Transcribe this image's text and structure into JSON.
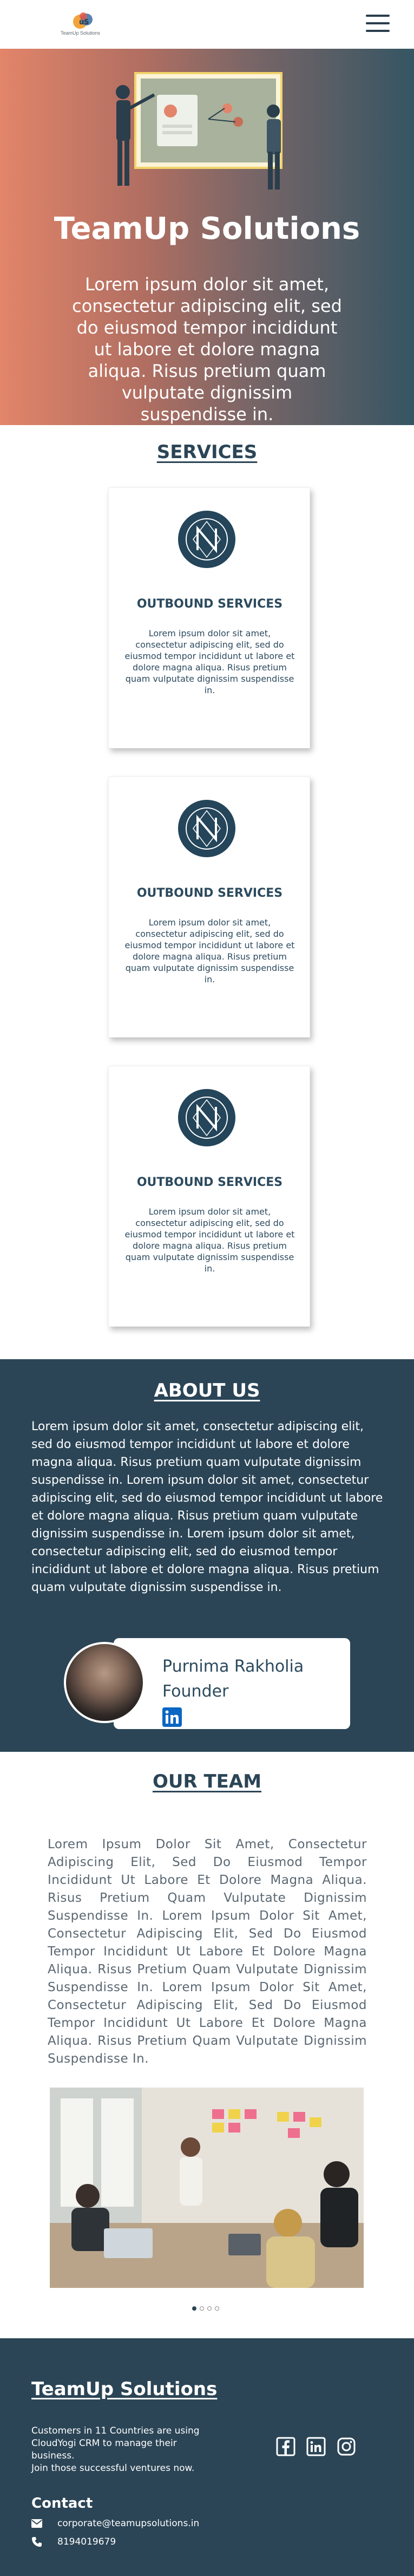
{
  "header": {
    "logo_text": "TeamUp Solutions",
    "menu_icon": "hamburger-menu-icon"
  },
  "hero": {
    "title": "TeamUp Solutions",
    "text": "Lorem ipsum dolor sit amet, consectetur adipiscing elit, sed do eiusmod tempor incididunt ut labore et dolore magna aliqua. Risus pretium quam vulputate dignissim suspendisse in.",
    "gradient": [
      "#e2856a",
      "#355563"
    ]
  },
  "services": {
    "heading": "SERVICES",
    "cards": [
      {
        "icon": "n-logo-icon",
        "title": "OUTBOUND SERVICES",
        "text": "Lorem ipsum dolor sit amet, consectetur adipiscing elit, sed do eiusmod tempor incididunt ut labore et dolore magna aliqua. Risus pretium quam vulputate dignissim suspendisse in."
      },
      {
        "icon": "n-logo-icon",
        "title": "OUTBOUND SERVICES",
        "text": "Lorem ipsum dolor sit amet, consectetur adipiscing elit, sed do eiusmod tempor incididunt ut labore et dolore magna aliqua. Risus pretium quam vulputate dignissim suspendisse in."
      },
      {
        "icon": "n-logo-icon",
        "title": "OUTBOUND SERVICES",
        "text": "Lorem ipsum dolor sit amet, consectetur adipiscing elit, sed do eiusmod tempor incididunt ut labore et dolore magna aliqua. Risus pretium quam vulputate dignissim suspendisse in."
      }
    ]
  },
  "about": {
    "heading": "ABOUT US",
    "text": "Lorem ipsum dolor sit amet, consectetur adipiscing elit, sed do eiusmod tempor incididunt ut labore et dolore magna aliqua. Risus pretium quam vulputate dignissim suspendisse in. Lorem ipsum dolor sit amet, consectetur adipiscing elit, sed do eiusmod tempor incididunt ut labore et dolore magna aliqua. Risus pretium quam vulputate dignissim suspendisse in. Lorem ipsum dolor sit amet, consectetur adipiscing elit, sed do eiusmod tempor incididunt ut labore et dolore magna aliqua. Risus pretium quam vulputate dignissim suspendisse in.",
    "founder": {
      "name": "Purnima Rakholia",
      "role": "Founder",
      "social_icon": "linkedin-icon"
    }
  },
  "team": {
    "heading": "OUR TEAM",
    "text": "Lorem Ipsum Dolor Sit Amet, Consectetur Adipiscing Elit, Sed Do Eiusmod Tempor Incididunt Ut Labore Et Dolore Magna Aliqua. Risus Pretium Quam Vulputate Dignissim Suspendisse In. Lorem Ipsum Dolor Sit Amet, Consectetur Adipiscing Elit, Sed Do Eiusmod Tempor Incididunt Ut Labore Et Dolore Magna Aliqua. Risus Pretium Quam Vulputate Dignissim Suspendisse In. Lorem Ipsum Dolor Sit Amet, Consectetur Adipiscing Elit, Sed Do Eiusmod Tempor Incididunt Ut Labore Et Dolore Magna Aliqua. Risus Pretium Quam Vulputate Dignissim Suspendisse In.",
    "carousel": {
      "slides": 4,
      "active": 1
    }
  },
  "footer": {
    "title": "TeamUp Solutions",
    "desc_line1": "Customers in 11 Countries are using CloudYogi CRM to manage their business.",
    "desc_line2": "Join those successful ventures now.",
    "social_icons": [
      "facebook-icon",
      "linkedin-icon",
      "instagram-icon"
    ],
    "contact_heading": "Contact",
    "email": "corporate@teamupsolutions.in",
    "phone": "8194019679"
  },
  "colors": {
    "primary_dark": "#2b4556",
    "hero_left": "#e2856a",
    "white": "#ffffff"
  }
}
